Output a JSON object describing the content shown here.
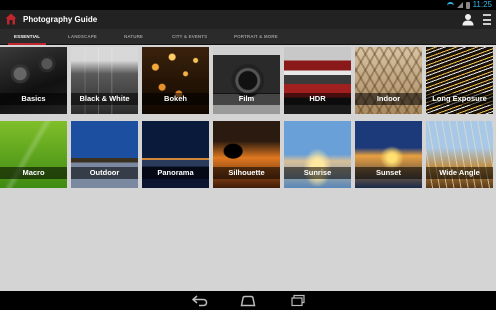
{
  "status_bar": {
    "time": "11:25",
    "icons": [
      "wifi-icon",
      "signal-icon",
      "battery-icon"
    ],
    "accent_color": "#33b5e5"
  },
  "action_bar": {
    "title": "Photography Guide",
    "logo_icon": "house-icon",
    "logo_color": "#c0262d",
    "actions": [
      "profile-icon",
      "overflow-menu-icon"
    ]
  },
  "tabs": [
    {
      "label": "ESSENTIAL",
      "active": true
    },
    {
      "label": "LANDSCAPE",
      "active": false
    },
    {
      "label": "NATURE",
      "active": false
    },
    {
      "label": "CITY & EVENTS",
      "active": false
    },
    {
      "label": "PORTRAIT & MORE",
      "active": false
    }
  ],
  "tab_indicator_color": "#c0262d",
  "tiles": [
    {
      "label": "Basics"
    },
    {
      "label": "Black & White"
    },
    {
      "label": "Bokeh"
    },
    {
      "label": "Film"
    },
    {
      "label": "HDR"
    },
    {
      "label": "Indoor"
    },
    {
      "label": "Long Exposure"
    },
    {
      "label": "Macro"
    },
    {
      "label": "Outdoor"
    },
    {
      "label": "Panorama"
    },
    {
      "label": "Silhouette"
    },
    {
      "label": "Sunrise"
    },
    {
      "label": "Sunset"
    },
    {
      "label": "Wide Angle"
    }
  ],
  "nav_bar": {
    "buttons": [
      "back-icon",
      "home-icon",
      "recent-apps-icon"
    ]
  }
}
